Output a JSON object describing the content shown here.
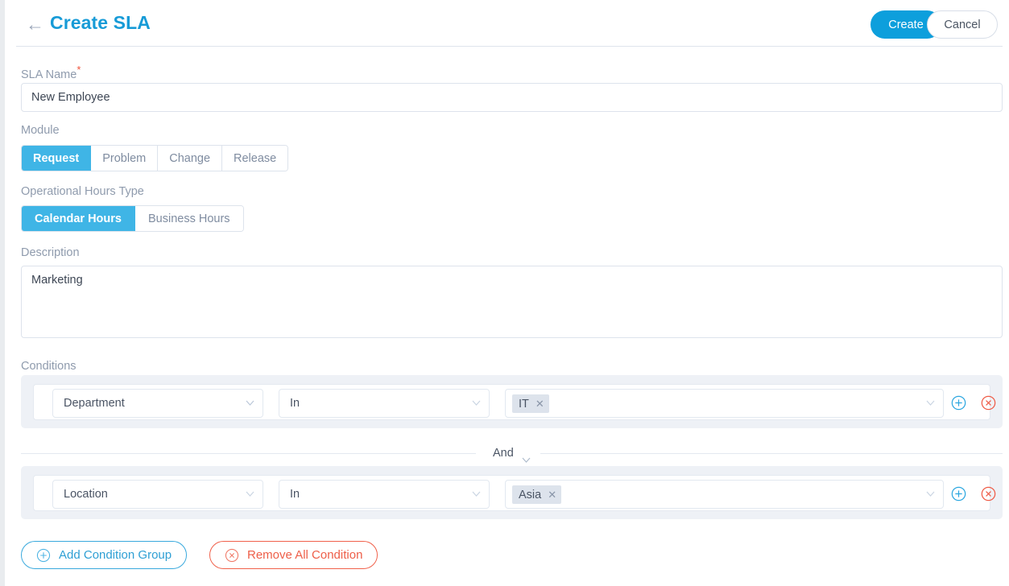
{
  "header": {
    "back_icon": "arrow-left-icon",
    "title": "Create SLA",
    "create_label": "Create",
    "cancel_label": "Cancel",
    "accent_blue": "#0d9fdc",
    "title_blue": "#179bd7"
  },
  "form": {
    "sla_name": {
      "label": "SLA Name",
      "required_mark": "*",
      "value": "New Employee",
      "placeholder": ""
    },
    "module": {
      "label": "Module",
      "options": [
        "Request",
        "Problem",
        "Change",
        "Release"
      ],
      "selected": "Request"
    },
    "operational_hours_type": {
      "label": "Operational Hours Type",
      "options": [
        "Calendar Hours",
        "Business Hours"
      ],
      "selected": "Calendar Hours"
    },
    "description": {
      "label": "Description",
      "value": "Marketing",
      "placeholder": ""
    }
  },
  "conditions": {
    "label": "Conditions",
    "connector": {
      "label": "And",
      "icon": "chevron-down-icon"
    },
    "rows": [
      {
        "field": "Department",
        "operator": "In",
        "values": [
          "IT"
        ],
        "add_icon": "circle-plus-icon",
        "remove_icon": "circle-x-icon"
      },
      {
        "field": "Location",
        "operator": "In",
        "values": [
          "Asia"
        ],
        "add_icon": "circle-plus-icon",
        "remove_icon": "circle-x-icon"
      }
    ],
    "actions": {
      "add_group_label": "Add Condition Group",
      "add_group_icon": "circle-plus-icon",
      "remove_all_label": "Remove All Condition",
      "remove_all_icon": "circle-x-icon",
      "add_color": "#2e9fd4",
      "remove_color": "#ee5e48"
    }
  }
}
